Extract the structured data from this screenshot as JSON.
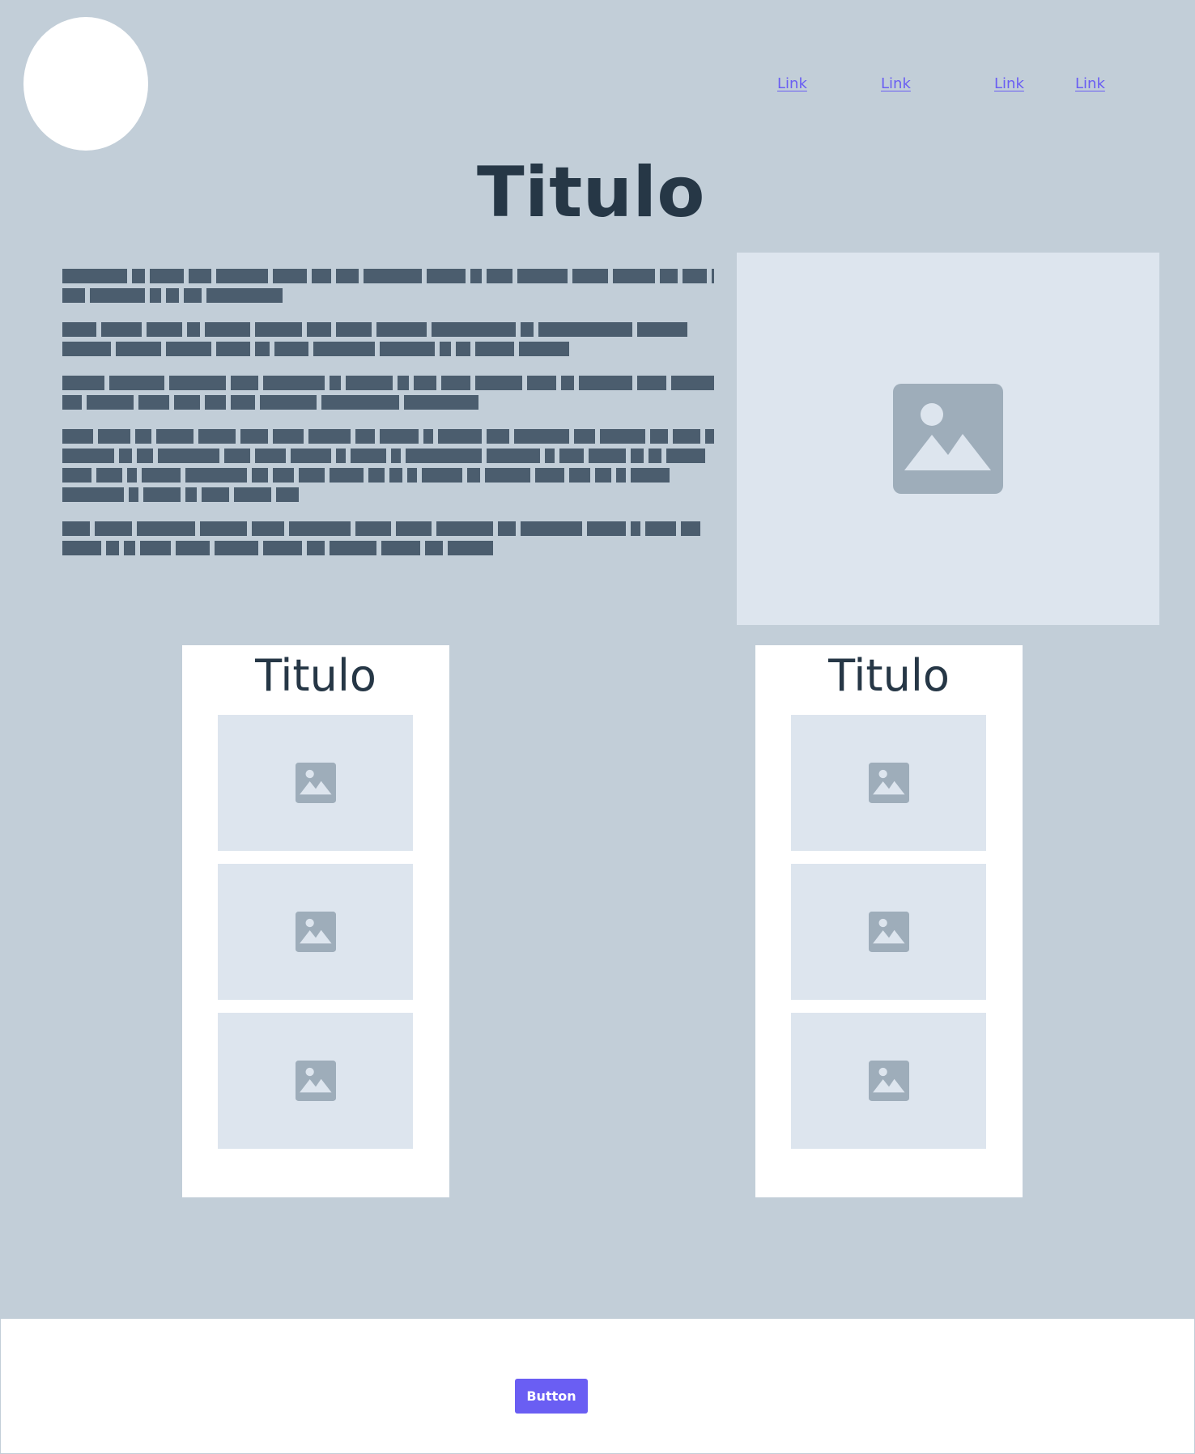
{
  "header": {
    "nav_links": [
      "Link",
      "Link",
      "Link",
      "Link"
    ]
  },
  "main": {
    "title": "Titulo"
  },
  "cards": [
    {
      "title": "Titulo"
    },
    {
      "title": "Titulo"
    }
  ],
  "footer": {
    "button_label": "Button"
  },
  "colors": {
    "background": "#c2ced8",
    "placeholder": "#dde5ee",
    "placeholder_icon": "#9eadba",
    "text_dark": "#263746",
    "redacted_text": "#4b5d6e",
    "accent": "#6a5ef3"
  },
  "icons": {
    "logo": "logo-placeholder",
    "image": "image-placeholder-icon"
  }
}
